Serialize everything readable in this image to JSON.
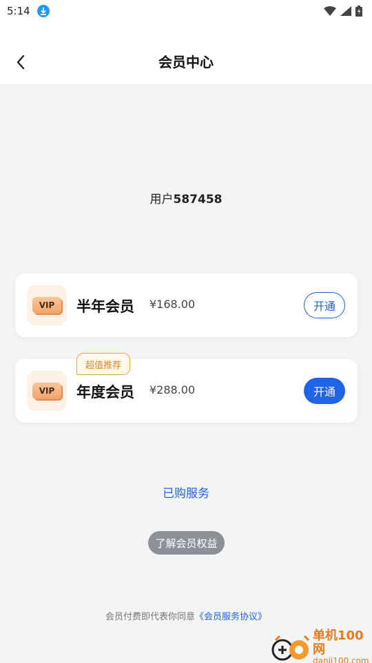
{
  "status_bar": {
    "time": "5:14",
    "download_icon": "download-icon",
    "wifi_icon": "wifi-icon",
    "signal_icon": "signal-icon",
    "battery_icon": "battery-icon"
  },
  "header": {
    "title": "会员中心",
    "back_icon": "chevron-left-icon"
  },
  "user": {
    "prefix": "用户",
    "id": "587458"
  },
  "plans": [
    {
      "badge": "VIP",
      "name": "半年会员",
      "price": "¥168.00",
      "button": "开通",
      "button_style": "outline"
    },
    {
      "badge": "VIP",
      "name": "年度会员",
      "price": "¥288.00",
      "button": "开通",
      "button_style": "filled",
      "tag": "超值推荐"
    }
  ],
  "purchased_link": "已购服务",
  "benefits_button": "了解会员权益",
  "agreement": {
    "text": "会员付费即代表你同意",
    "link": "《会员服务协议》"
  },
  "watermark": {
    "cn": "单机100网",
    "en": "danji100.com"
  },
  "colors": {
    "accent_blue": "#1f63e6",
    "tag_orange": "#e08a2a",
    "background": "#f3f4f6"
  }
}
